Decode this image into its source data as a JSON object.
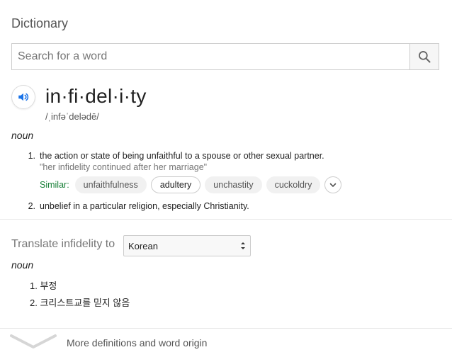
{
  "dictionary": {
    "title": "Dictionary",
    "search": {
      "placeholder": "Search for a word",
      "value": ""
    },
    "icons": {
      "search": "search-icon",
      "speaker": "speaker-icon",
      "expand": "chevron-down-icon"
    }
  },
  "entry": {
    "headword": "in·fi·del·i·ty",
    "phonetic": "/ˌinfəˈdelədē/",
    "part_of_speech": "noun",
    "definitions": [
      {
        "number": "1.",
        "text": "the action or state of being unfaithful to a spouse or other sexual partner.",
        "example": "\"her infidelity continued after her marriage\"",
        "similar_label": "Similar:",
        "similar": [
          "unfaithfulness",
          "adultery",
          "unchastity",
          "cuckoldry"
        ]
      },
      {
        "number": "2.",
        "text": "unbelief in a particular religion, especially Christianity."
      }
    ]
  },
  "translate": {
    "label": "Translate infidelity to",
    "selected_language": "Korean",
    "part_of_speech": "noun",
    "items": [
      {
        "number": "1.",
        "text": "부정"
      },
      {
        "number": "2.",
        "text": "크리스트교를 믿지 않음"
      }
    ]
  },
  "more": {
    "label": "More definitions and word origin"
  },
  "colors": {
    "accent_blue": "#1a73e8",
    "similar_green": "#188038",
    "muted_text": "#777777"
  }
}
